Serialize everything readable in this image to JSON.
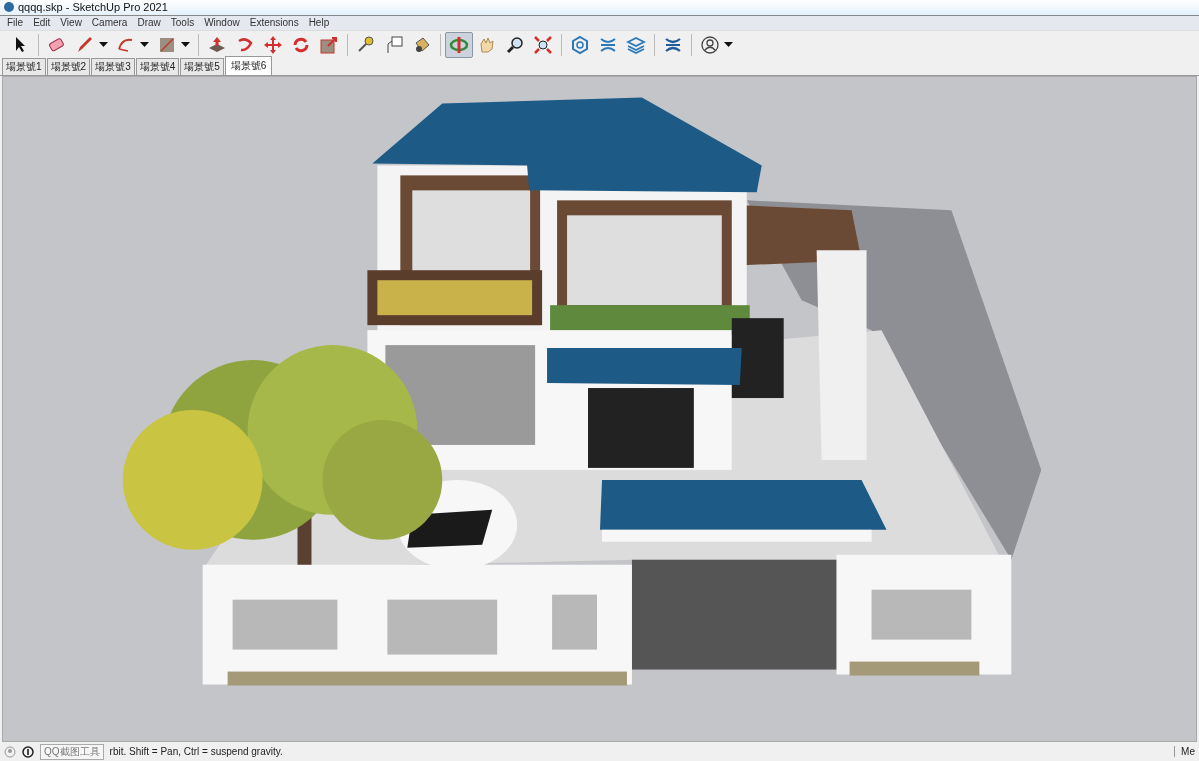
{
  "window": {
    "title": "qqqq.skp - SketchUp Pro 2021"
  },
  "menu": [
    "File",
    "Edit",
    "View",
    "Camera",
    "Draw",
    "Tools",
    "Window",
    "Extensions",
    "Help"
  ],
  "toolbar": [
    {
      "selected": false,
      "dropdown": false
    },
    {
      "selected": false,
      "dropdown": false
    },
    {
      "selected": false,
      "dropdown": true
    },
    {
      "selected": false,
      "dropdown": true
    },
    {
      "selected": false,
      "dropdown": true
    },
    {
      "selected": false,
      "dropdown": false
    },
    {
      "selected": false,
      "dropdown": false
    },
    {
      "selected": false,
      "dropdown": false
    },
    {
      "selected": false,
      "dropdown": false
    },
    {
      "selected": false,
      "dropdown": false
    },
    {
      "selected": false,
      "dropdown": false
    },
    {
      "selected": false,
      "dropdown": false
    },
    {
      "selected": false,
      "dropdown": false
    },
    {
      "selected": true,
      "dropdown": false
    },
    {
      "selected": false,
      "dropdown": false
    },
    {
      "selected": false,
      "dropdown": false
    },
    {
      "selected": false,
      "dropdown": false
    },
    {
      "selected": false,
      "dropdown": false
    },
    {
      "selected": false,
      "dropdown": false
    },
    {
      "selected": false,
      "dropdown": false
    },
    {
      "selected": false,
      "dropdown": false
    },
    {
      "selected": false,
      "dropdown": true
    }
  ],
  "scene_tabs": [
    {
      "label": "場景號1",
      "selected": false
    },
    {
      "label": "場景號2",
      "selected": false
    },
    {
      "label": "場景號3",
      "selected": false
    },
    {
      "label": "場景號4",
      "selected": false
    },
    {
      "label": "場景號5",
      "selected": false
    },
    {
      "label": "場景號6",
      "selected": true
    }
  ],
  "status_bar": {
    "tooltip": "QQ截图工具",
    "text": "rbit. Shift = Pan, Ctrl = suspend gravity.",
    "measurements_label": "Me"
  }
}
